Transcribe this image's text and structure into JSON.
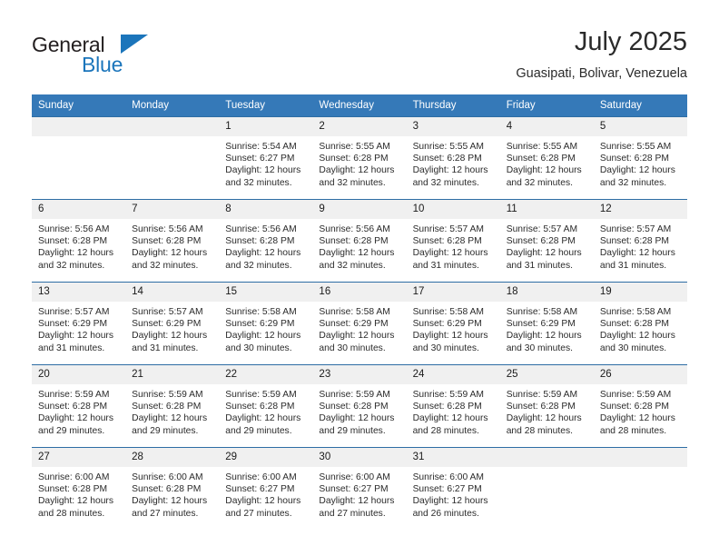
{
  "brand": {
    "name_part1": "General",
    "name_part2": "Blue",
    "logo_icon": "triangle-logo-icon",
    "accent_color": "#1b75bb"
  },
  "header": {
    "title": "July 2025",
    "subtitle": "Guasipati, Bolivar, Venezuela"
  },
  "calendar": {
    "header_bg": "#3579b8",
    "daynum_bg": "#f0f0f0",
    "row_divider_color": "#2e6da4",
    "weekday_headers": [
      "Sunday",
      "Monday",
      "Tuesday",
      "Wednesday",
      "Thursday",
      "Friday",
      "Saturday"
    ],
    "weeks": [
      [
        {
          "day": "",
          "sunrise": "",
          "sunset": "",
          "daylight": "",
          "empty": true
        },
        {
          "day": "",
          "sunrise": "",
          "sunset": "",
          "daylight": "",
          "empty": true
        },
        {
          "day": "1",
          "sunrise": "Sunrise: 5:54 AM",
          "sunset": "Sunset: 6:27 PM",
          "daylight": "Daylight: 12 hours and 32 minutes.",
          "empty": false
        },
        {
          "day": "2",
          "sunrise": "Sunrise: 5:55 AM",
          "sunset": "Sunset: 6:28 PM",
          "daylight": "Daylight: 12 hours and 32 minutes.",
          "empty": false
        },
        {
          "day": "3",
          "sunrise": "Sunrise: 5:55 AM",
          "sunset": "Sunset: 6:28 PM",
          "daylight": "Daylight: 12 hours and 32 minutes.",
          "empty": false
        },
        {
          "day": "4",
          "sunrise": "Sunrise: 5:55 AM",
          "sunset": "Sunset: 6:28 PM",
          "daylight": "Daylight: 12 hours and 32 minutes.",
          "empty": false
        },
        {
          "day": "5",
          "sunrise": "Sunrise: 5:55 AM",
          "sunset": "Sunset: 6:28 PM",
          "daylight": "Daylight: 12 hours and 32 minutes.",
          "empty": false
        }
      ],
      [
        {
          "day": "6",
          "sunrise": "Sunrise: 5:56 AM",
          "sunset": "Sunset: 6:28 PM",
          "daylight": "Daylight: 12 hours and 32 minutes.",
          "empty": false
        },
        {
          "day": "7",
          "sunrise": "Sunrise: 5:56 AM",
          "sunset": "Sunset: 6:28 PM",
          "daylight": "Daylight: 12 hours and 32 minutes.",
          "empty": false
        },
        {
          "day": "8",
          "sunrise": "Sunrise: 5:56 AM",
          "sunset": "Sunset: 6:28 PM",
          "daylight": "Daylight: 12 hours and 32 minutes.",
          "empty": false
        },
        {
          "day": "9",
          "sunrise": "Sunrise: 5:56 AM",
          "sunset": "Sunset: 6:28 PM",
          "daylight": "Daylight: 12 hours and 32 minutes.",
          "empty": false
        },
        {
          "day": "10",
          "sunrise": "Sunrise: 5:57 AM",
          "sunset": "Sunset: 6:28 PM",
          "daylight": "Daylight: 12 hours and 31 minutes.",
          "empty": false
        },
        {
          "day": "11",
          "sunrise": "Sunrise: 5:57 AM",
          "sunset": "Sunset: 6:28 PM",
          "daylight": "Daylight: 12 hours and 31 minutes.",
          "empty": false
        },
        {
          "day": "12",
          "sunrise": "Sunrise: 5:57 AM",
          "sunset": "Sunset: 6:28 PM",
          "daylight": "Daylight: 12 hours and 31 minutes.",
          "empty": false
        }
      ],
      [
        {
          "day": "13",
          "sunrise": "Sunrise: 5:57 AM",
          "sunset": "Sunset: 6:29 PM",
          "daylight": "Daylight: 12 hours and 31 minutes.",
          "empty": false
        },
        {
          "day": "14",
          "sunrise": "Sunrise: 5:57 AM",
          "sunset": "Sunset: 6:29 PM",
          "daylight": "Daylight: 12 hours and 31 minutes.",
          "empty": false
        },
        {
          "day": "15",
          "sunrise": "Sunrise: 5:58 AM",
          "sunset": "Sunset: 6:29 PM",
          "daylight": "Daylight: 12 hours and 30 minutes.",
          "empty": false
        },
        {
          "day": "16",
          "sunrise": "Sunrise: 5:58 AM",
          "sunset": "Sunset: 6:29 PM",
          "daylight": "Daylight: 12 hours and 30 minutes.",
          "empty": false
        },
        {
          "day": "17",
          "sunrise": "Sunrise: 5:58 AM",
          "sunset": "Sunset: 6:29 PM",
          "daylight": "Daylight: 12 hours and 30 minutes.",
          "empty": false
        },
        {
          "day": "18",
          "sunrise": "Sunrise: 5:58 AM",
          "sunset": "Sunset: 6:29 PM",
          "daylight": "Daylight: 12 hours and 30 minutes.",
          "empty": false
        },
        {
          "day": "19",
          "sunrise": "Sunrise: 5:58 AM",
          "sunset": "Sunset: 6:28 PM",
          "daylight": "Daylight: 12 hours and 30 minutes.",
          "empty": false
        }
      ],
      [
        {
          "day": "20",
          "sunrise": "Sunrise: 5:59 AM",
          "sunset": "Sunset: 6:28 PM",
          "daylight": "Daylight: 12 hours and 29 minutes.",
          "empty": false
        },
        {
          "day": "21",
          "sunrise": "Sunrise: 5:59 AM",
          "sunset": "Sunset: 6:28 PM",
          "daylight": "Daylight: 12 hours and 29 minutes.",
          "empty": false
        },
        {
          "day": "22",
          "sunrise": "Sunrise: 5:59 AM",
          "sunset": "Sunset: 6:28 PM",
          "daylight": "Daylight: 12 hours and 29 minutes.",
          "empty": false
        },
        {
          "day": "23",
          "sunrise": "Sunrise: 5:59 AM",
          "sunset": "Sunset: 6:28 PM",
          "daylight": "Daylight: 12 hours and 29 minutes.",
          "empty": false
        },
        {
          "day": "24",
          "sunrise": "Sunrise: 5:59 AM",
          "sunset": "Sunset: 6:28 PM",
          "daylight": "Daylight: 12 hours and 28 minutes.",
          "empty": false
        },
        {
          "day": "25",
          "sunrise": "Sunrise: 5:59 AM",
          "sunset": "Sunset: 6:28 PM",
          "daylight": "Daylight: 12 hours and 28 minutes.",
          "empty": false
        },
        {
          "day": "26",
          "sunrise": "Sunrise: 5:59 AM",
          "sunset": "Sunset: 6:28 PM",
          "daylight": "Daylight: 12 hours and 28 minutes.",
          "empty": false
        }
      ],
      [
        {
          "day": "27",
          "sunrise": "Sunrise: 6:00 AM",
          "sunset": "Sunset: 6:28 PM",
          "daylight": "Daylight: 12 hours and 28 minutes.",
          "empty": false
        },
        {
          "day": "28",
          "sunrise": "Sunrise: 6:00 AM",
          "sunset": "Sunset: 6:28 PM",
          "daylight": "Daylight: 12 hours and 27 minutes.",
          "empty": false
        },
        {
          "day": "29",
          "sunrise": "Sunrise: 6:00 AM",
          "sunset": "Sunset: 6:27 PM",
          "daylight": "Daylight: 12 hours and 27 minutes.",
          "empty": false
        },
        {
          "day": "30",
          "sunrise": "Sunrise: 6:00 AM",
          "sunset": "Sunset: 6:27 PM",
          "daylight": "Daylight: 12 hours and 27 minutes.",
          "empty": false
        },
        {
          "day": "31",
          "sunrise": "Sunrise: 6:00 AM",
          "sunset": "Sunset: 6:27 PM",
          "daylight": "Daylight: 12 hours and 26 minutes.",
          "empty": false
        },
        {
          "day": "",
          "sunrise": "",
          "sunset": "",
          "daylight": "",
          "empty": true
        },
        {
          "day": "",
          "sunrise": "",
          "sunset": "",
          "daylight": "",
          "empty": true
        }
      ]
    ]
  }
}
